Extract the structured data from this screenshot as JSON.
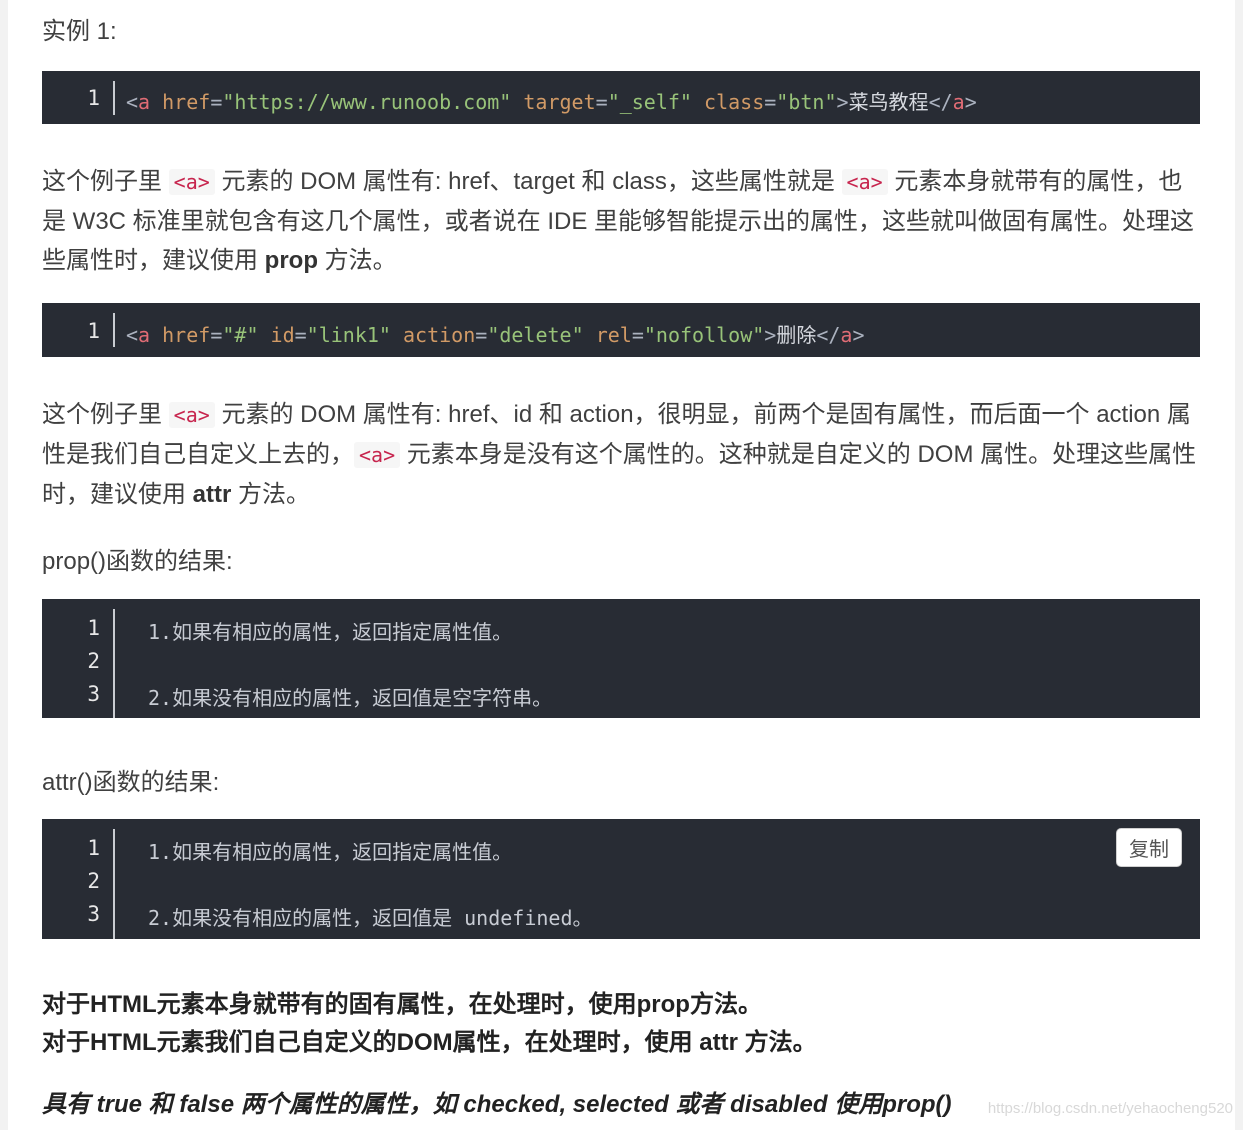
{
  "example_title": "实例 1:",
  "code1": {
    "line_numbers": [
      "1"
    ],
    "tokens": [
      "<",
      "a",
      " ",
      "href",
      "=",
      "\"https://www.runoob.com\"",
      " ",
      "target",
      "=",
      "\"_self\"",
      " ",
      "class",
      "=",
      "\"btn\"",
      ">",
      "菜鸟教程",
      "</",
      "a",
      ">"
    ]
  },
  "para1": {
    "l1_a": "这个例子里 ",
    "l1_code_a": "<a>",
    "l1_b": " 元素的 DOM 属性有: href、target 和 class，这些属性就是 ",
    "l1_code_b": "<a>",
    "l1_c": " 元素本身就带有的属性，也",
    "l2": "是 W3C 标准里就包含有这几个属性，或者说在 IDE 里能够智能提示出的属性，这些就叫做固有属性。处理这",
    "l3_a": "些属性时，建议使用 ",
    "l3_bold": "prop",
    "l3_b": " 方法。"
  },
  "code2": {
    "line_numbers": [
      "1"
    ],
    "tokens": [
      "<",
      "a",
      " ",
      "href",
      "=",
      "\"#\"",
      " ",
      "id",
      "=",
      "\"link1\"",
      " ",
      "action",
      "=",
      "\"delete\"",
      " ",
      "rel",
      "=",
      "\"nofollow\"",
      ">",
      "删除",
      "</",
      "a",
      ">"
    ]
  },
  "para2": {
    "l1_a": "这个例子里 ",
    "l1_code": "<a>",
    "l1_b": " 元素的 DOM 属性有: href、id 和 action，很明显，前两个是固有属性，而后面一个 action 属",
    "l2_a": "性是我们自己自定义上去的，",
    "l2_code": "<a>",
    "l2_b": " 元素本身是没有这个属性的。这种就是自定义的 DOM 属性。处理这些属性",
    "l3_a": "时，建议使用 ",
    "l3_bold": "attr",
    "l3_b": " 方法。"
  },
  "prop_heading": "prop()函数的结果:",
  "code3": {
    "line_numbers": [
      "1",
      "2",
      "3"
    ],
    "lines": [
      "1.如果有相应的属性，返回指定属性值。",
      "",
      "2.如果没有相应的属性，返回值是空字符串。"
    ]
  },
  "attr_heading": "attr()函数的结果:",
  "code4": {
    "line_numbers": [
      "1",
      "2",
      "3"
    ],
    "lines": [
      "1.如果有相应的属性，返回指定属性值。",
      "",
      "2.如果没有相应的属性，返回值是 undefined。"
    ],
    "copy_label": "复制"
  },
  "summary": {
    "line1": "对于HTML元素本身就带有的固有属性，在处理时，使用prop方法。",
    "line2": "对于HTML元素我们自己自定义的DOM属性，在处理时，使用 attr 方法。"
  },
  "emphasis": "具有 true 和 false 两个属性的属性，如 checked, selected 或者 disabled 使用prop()",
  "watermark": "https://blog.csdn.net/yehaocheng520",
  "colors": {
    "code_bg": "#282c34",
    "tag": "#e06c75",
    "attr": "#d19a66",
    "string": "#98c379",
    "inline_code": "#c7254e"
  }
}
